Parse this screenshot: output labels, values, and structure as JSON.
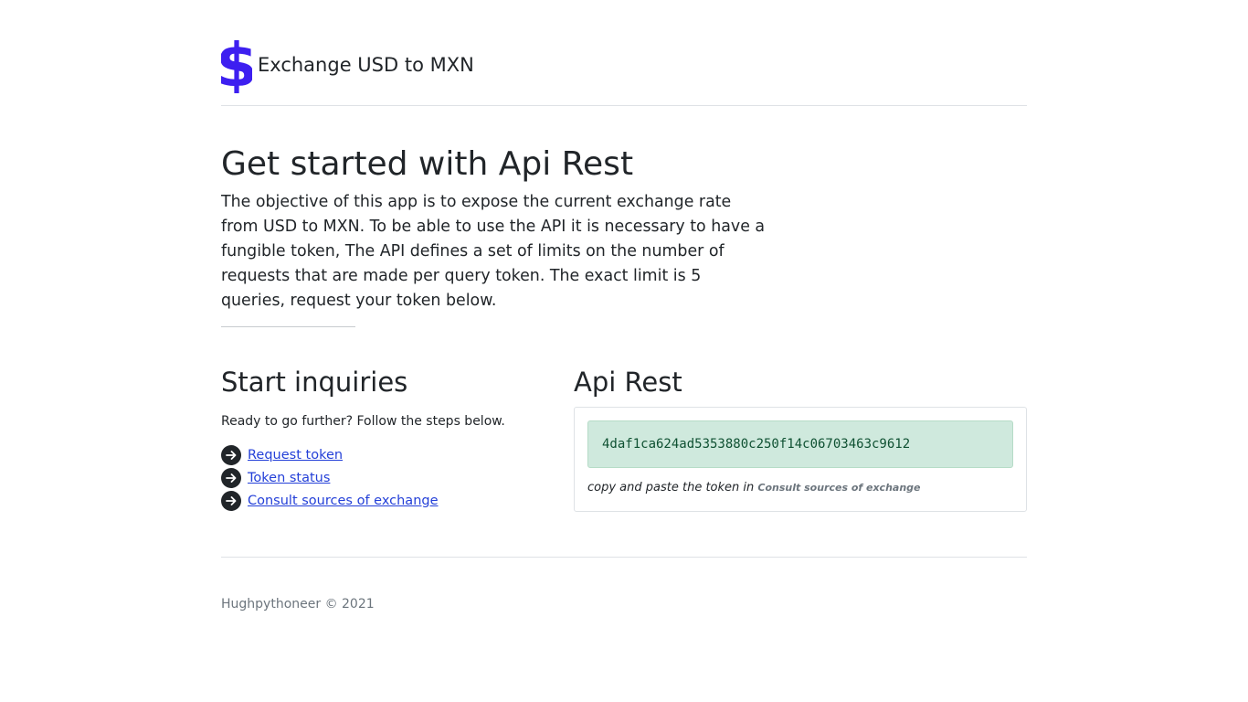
{
  "header": {
    "brand_icon": "dollar-icon",
    "brand_color": "#3d1ff0",
    "title": "Exchange USD to MXN"
  },
  "hero": {
    "title": "Get started with Api Rest",
    "description": "The objective of this app is to expose the current exchange rate from USD to MXN. To be able to use the API it is necessary to have a fungible token, The API defines a set of limits on the number of requests that are made per query token. The exact limit is 5 queries, request your token below."
  },
  "inquiries": {
    "title": "Start inquiries",
    "subtitle": "Ready to go further? Follow the steps below.",
    "links": [
      {
        "label": "Request token",
        "icon": "arrow-right-circle-icon"
      },
      {
        "label": "Token status",
        "icon": "arrow-right-circle-icon"
      },
      {
        "label": "Consult sources of exchange",
        "icon": "arrow-right-circle-icon"
      }
    ]
  },
  "api": {
    "title": "Api Rest",
    "token": "4daf1ca624ad5353880c250f14c06703463c9612",
    "hint_prefix": "copy and paste the token in",
    "hint_target": "Consult sources of exchange",
    "token_bg_color": "#cfe9dd"
  },
  "footer": {
    "text": "Hughpythoneer © 2021"
  }
}
